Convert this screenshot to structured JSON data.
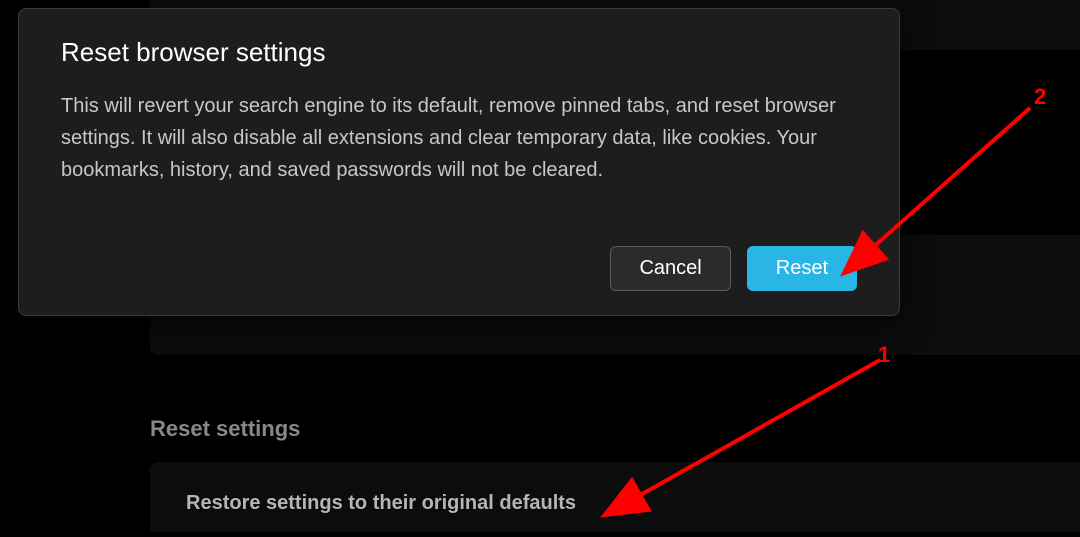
{
  "dialog": {
    "title": "Reset browser settings",
    "body": "This will revert your search engine to its default, remove pinned tabs, and reset browser settings. It will also disable all extensions and clear temporary data, like cookies. Your bookmarks, history, and saved passwords will not be cleared.",
    "cancel_label": "Cancel",
    "confirm_label": "Reset"
  },
  "page": {
    "section_heading": "Reset settings",
    "restore_item": "Restore settings to their original defaults"
  },
  "annotations": {
    "label1": "1",
    "label2": "2"
  },
  "colors": {
    "accent": "#29b6e6",
    "annotation": "#ff0000",
    "dialog_bg": "#1d1d1d",
    "page_bg": "#000000"
  }
}
